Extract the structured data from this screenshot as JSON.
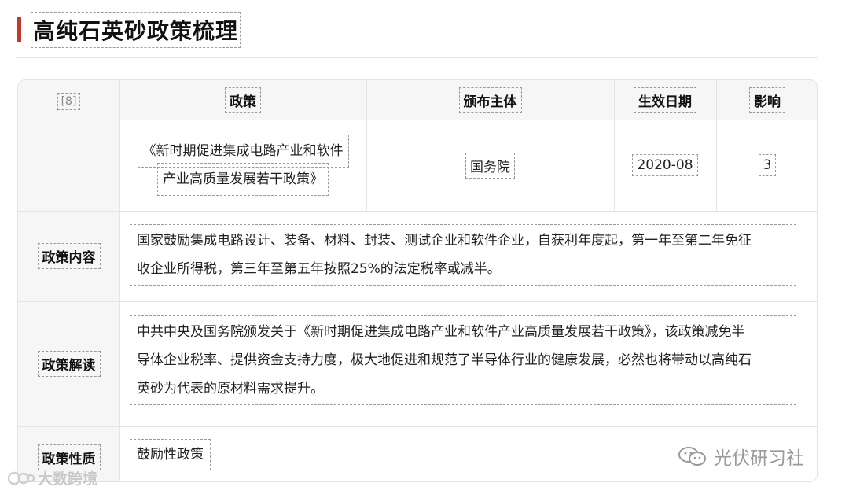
{
  "page": {
    "title": "高纯石英砂政策梳理"
  },
  "table": {
    "ref": "[8]",
    "headers": {
      "policy": "政策",
      "issuer": "颁布主体",
      "effective_date": "生效日期",
      "impact": "影响"
    },
    "row": {
      "policy_line1": "《新时期促进集成电路产业和软件",
      "policy_line2": "产业高质量发展若干政策》",
      "issuer": "国务院",
      "effective_date": "2020-08",
      "impact": "3"
    },
    "content": {
      "label": "政策内容",
      "line1": "国家鼓励集成电路设计、装备、材料、封装、测试企业和软件企业，自获利年度起，第一年至第二年免征",
      "line2": "收企业所得税，第三年至第五年按照25%的法定税率或减半。"
    },
    "interpretation": {
      "label": "政策解读",
      "line1": "中共中央及国务院颁发关于《新时期促进集成电路产业和软件产业高质量发展若干政策》，该政策减免半",
      "line2": "导体企业税率、提供资金支持力度，极大地促进和规范了半导体行业的健康发展，必然也将带动以高纯石",
      "line3": "英砂为代表的原材料需求提升。"
    },
    "nature": {
      "label": "政策性质",
      "value": "鼓励性政策"
    }
  },
  "watermarks": {
    "left": "大数跨境",
    "right": "光伏研习社",
    "left_icon": "brand-logo-icon",
    "right_icon": "wechat-icon"
  },
  "colors": {
    "accent": "#c0392b"
  }
}
